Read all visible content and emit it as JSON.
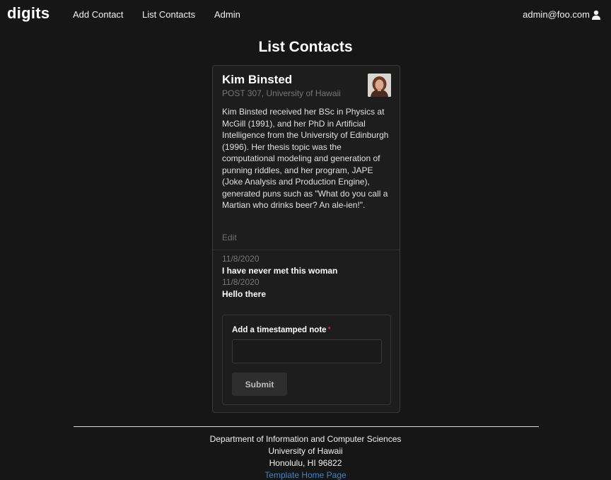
{
  "nav": {
    "brand": "digits",
    "links": [
      "Add Contact",
      "List Contacts",
      "Admin"
    ],
    "user": "admin@foo.com",
    "user_icon": "user-icon"
  },
  "page": {
    "title": "List Contacts"
  },
  "contact": {
    "name": "Kim Binsted",
    "address": "POST 307, University of Hawaii",
    "description": "Kim Binsted received her BSc in Physics at McGill (1991), and her PhD in Artificial Intelligence from the University of Edinburgh (1996). Her thesis topic was the computational modeling and generation of punning riddles, and her program, JAPE (Joke Analysis and Production Engine), generated puns such as \"What do you call a Martian who drinks beer? An ale-ien!\".",
    "edit_label": "Edit",
    "notes": [
      {
        "date": "11/8/2020",
        "text": "I have never met this woman"
      },
      {
        "date": "11/8/2020",
        "text": "Hello there"
      }
    ]
  },
  "note_form": {
    "label": "Add a timestamped note",
    "required_marker": "*",
    "value": "",
    "submit_label": "Submit"
  },
  "footer": {
    "line1": "Department of Information and Computer Sciences",
    "line2": "University of Hawaii",
    "line3": "Honolulu, HI 96822",
    "link": "Template Home Page"
  },
  "colors": {
    "background": "#161616",
    "link": "#4183c4",
    "required": "#db2828"
  }
}
